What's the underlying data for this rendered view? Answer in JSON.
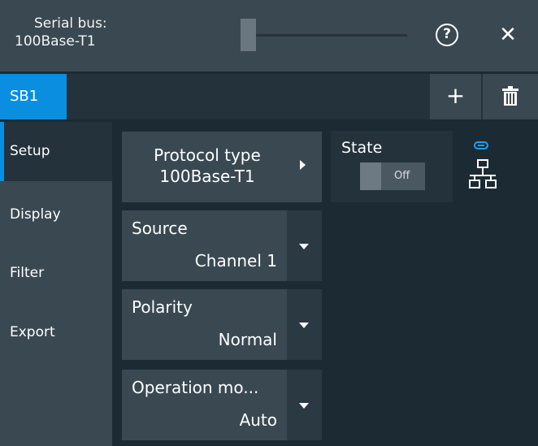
{
  "window": {
    "title_line1": "Serial bus:",
    "title_line2": "100Base-T1",
    "help_icon": "question-circle-icon",
    "close_icon": "close-icon",
    "help_glyph": "?",
    "close_glyph": "✕"
  },
  "tabs": {
    "items": [
      {
        "label": "SB1",
        "active": true
      }
    ],
    "add_icon": "plus-icon",
    "add_glyph": "+",
    "delete_icon": "trash-icon"
  },
  "sidebar": {
    "items": [
      {
        "label": "Setup",
        "active": true
      },
      {
        "label": "Display",
        "active": false
      },
      {
        "label": "Filter",
        "active": false
      },
      {
        "label": "Export",
        "active": false
      }
    ]
  },
  "setup": {
    "protocol_type": {
      "label": "Protocol type",
      "value": "100Base-T1"
    },
    "source": {
      "label": "Source",
      "value": "Channel 1"
    },
    "polarity": {
      "label": "Polarity",
      "value": "Normal"
    },
    "operation_mode": {
      "label": "Operation mo...",
      "value": "Auto"
    },
    "state": {
      "label": "State",
      "value": "Off"
    }
  },
  "colors": {
    "accent": "#0a8fe0",
    "background": "#1c2a33",
    "panel": "#3a4852"
  },
  "icons": [
    "link-icon",
    "network-icon"
  ]
}
